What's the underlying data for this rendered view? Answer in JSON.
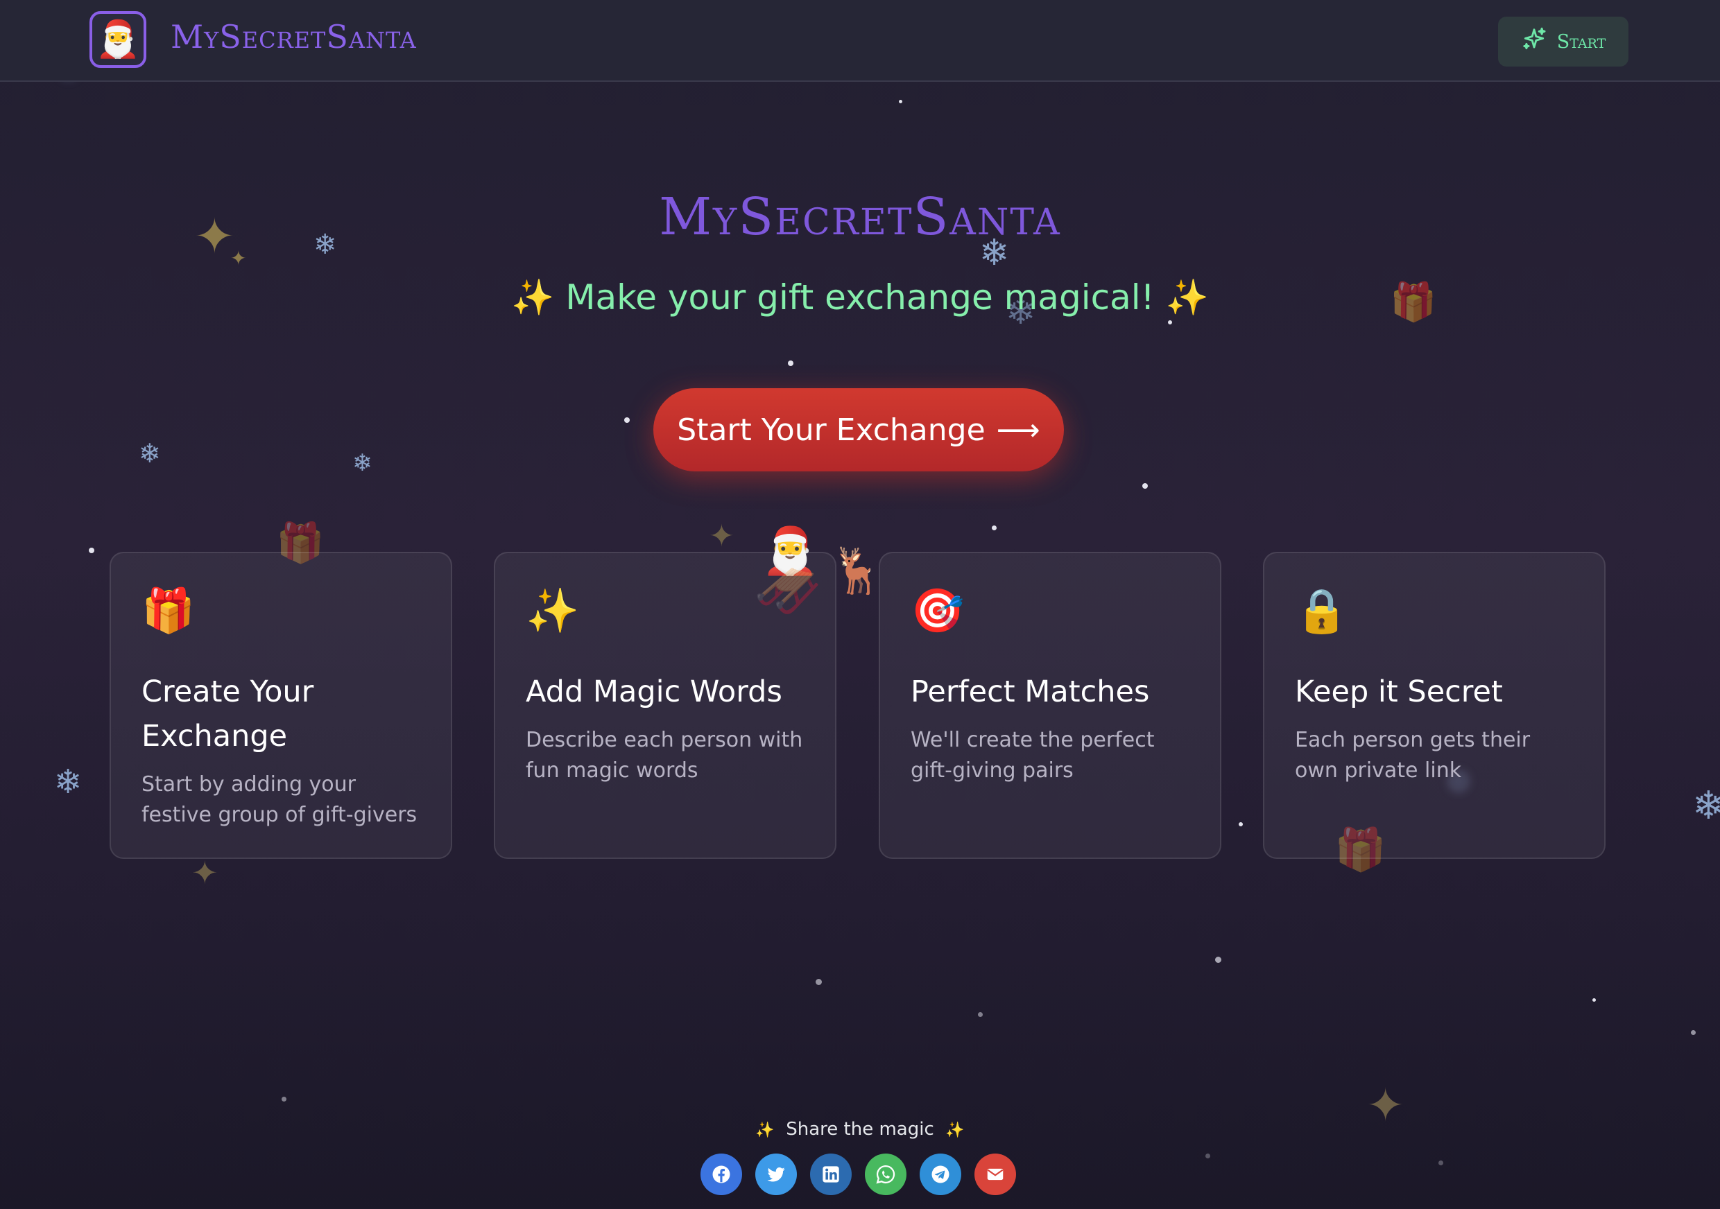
{
  "header": {
    "brand": "MySecretSanta",
    "start_label": "Start"
  },
  "hero": {
    "title": "MySecretSanta",
    "tagline_spark": "✨",
    "tagline": "Make your gift exchange magical!",
    "cta_label": "Start Your Exchange",
    "cta_arrow": "⟶"
  },
  "features": [
    {
      "icon": "🎁",
      "icon_name": "gift-icon",
      "title": "Create Your Exchange",
      "desc": "Start by adding your festive group of gift-givers"
    },
    {
      "icon": "✨",
      "icon_name": "sparkles-icon",
      "title": "Add Magic Words",
      "desc": "Describe each person with fun magic words"
    },
    {
      "icon": "🎯",
      "icon_name": "target-icon",
      "title": "Perfect Matches",
      "desc": "We'll create the perfect gift-giving pairs"
    },
    {
      "icon": "🔒",
      "icon_name": "lock-icon",
      "title": "Keep it Secret",
      "desc": "Each person gets their own private link"
    }
  ],
  "share": {
    "spark": "✨",
    "label": "Share the magic",
    "buttons": [
      {
        "name": "facebook",
        "color": "#3b74e0"
      },
      {
        "name": "twitter",
        "color": "#3d9ae8"
      },
      {
        "name": "linkedin",
        "color": "#2c6bb0"
      },
      {
        "name": "whatsapp",
        "color": "#48b95f"
      },
      {
        "name": "telegram",
        "color": "#2f8fd8"
      },
      {
        "name": "email",
        "color": "#d9443a"
      }
    ]
  },
  "colors": {
    "brand_purple": "#8a62ea",
    "tagline_green": "#86efac",
    "cta_red": "#c9302c",
    "start_green": "#6ee7a8"
  }
}
